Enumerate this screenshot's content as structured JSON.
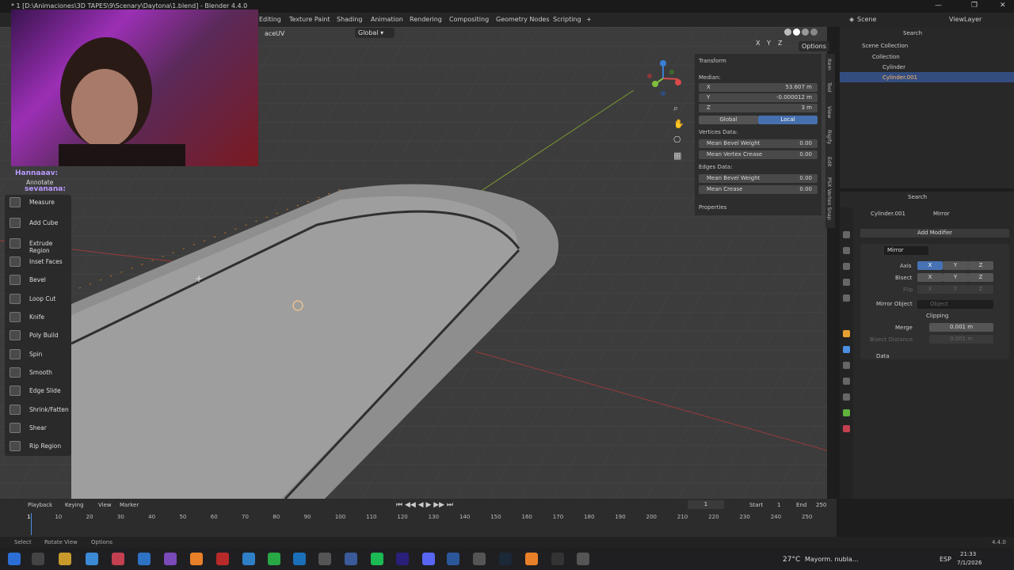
{
  "window": {
    "title": "* 1 [D:\\Animaciones\\3D TAPES\\9\\Scenary\\Daytona\\1.blend] - Blender 4.4.0",
    "minimize": "—",
    "maximize": "❐",
    "close": "✕"
  },
  "workspaces": [
    "Editing",
    "Texture Paint",
    "Shading",
    "Animation",
    "Rendering",
    "Compositing",
    "Geometry Nodes",
    "Scripting",
    "+"
  ],
  "scene": {
    "label": "Scene",
    "view_layer": "ViewLayer"
  },
  "viewport_header": {
    "face_label": "ace",
    "uv_label": "UV",
    "orientation": "Global",
    "options": "Options",
    "axes": [
      "X",
      "Y",
      "Z"
    ]
  },
  "webcam": {
    "chat_line1": "Hannaaav:",
    "chat_line2": "sevanana:"
  },
  "toolbar": {
    "items": [
      "Annotate",
      "Measure",
      "Add Cube",
      "Extrude Region",
      "Inset Faces",
      "Bevel",
      "Loop Cut",
      "Knife",
      "Poly Build",
      "Spin",
      "Smooth",
      "Edge Slide",
      "Shrink/Fatten",
      "Shear",
      "Rip Region"
    ]
  },
  "npanel": {
    "section": "Transform",
    "median": "Median:",
    "x_label": "X",
    "x": "53.607 m",
    "y_label": "Y",
    "y": "-0.000012 m",
    "z_label": "Z",
    "z": "3 m",
    "global": "Global",
    "local": "Local",
    "vertices": "Vertices Data:",
    "mean_bevel": "Mean Bevel Weight",
    "mean_bevel_v": "0.00",
    "mean_crease_v_label": "Mean Vertex Crease",
    "mean_crease_v": "0.00",
    "edges": "Edges Data:",
    "edge_bevel": "Mean Bevel Weight",
    "edge_bevel_v": "0.00",
    "edge_crease": "Mean Crease",
    "edge_crease_v": "0.00",
    "properties": "Properties",
    "tabs": [
      "Item",
      "Tool",
      "View",
      "Rigify",
      "Edit",
      "PSX Vertex Snap"
    ]
  },
  "outliner": {
    "search": "Search",
    "scene_collection": "Scene Collection",
    "collection": "Collection",
    "items": [
      "Cylinder",
      "Cylinder.001"
    ]
  },
  "properties": {
    "search": "Search",
    "breadcrumb_obj": "Cylinder.001",
    "breadcrumb_mod": "Mirror",
    "add_modifier": "Add Modifier",
    "modifier_name": "Mirror",
    "axis": "Axis",
    "bisect": "Bisect",
    "flip": "Flip",
    "x": "X",
    "y": "Y",
    "z": "Z",
    "mirror_object": "Mirror Object",
    "object_placeholder": "Object",
    "clipping": "Clipping",
    "merge": "Merge",
    "merge_value": "0.001 m",
    "bisect_distance": "Bisect Distance",
    "bisect_value": "0.001 m",
    "data": "Data"
  },
  "timeline": {
    "playback": "Playback",
    "keying": "Keying",
    "view": "View",
    "marker": "Marker",
    "current": "1",
    "start_label": "Start",
    "start": "1",
    "end_label": "End",
    "end": "250",
    "ticks": [
      "1",
      "10",
      "20",
      "30",
      "40",
      "50",
      "60",
      "70",
      "80",
      "90",
      "100",
      "110",
      "120",
      "130",
      "140",
      "150",
      "160",
      "170",
      "180",
      "190",
      "200",
      "210",
      "220",
      "230",
      "240",
      "250"
    ]
  },
  "status": {
    "select": "Select",
    "rotate": "Rotate View",
    "options": "Options",
    "version": "4.4.0"
  },
  "taskbar": {
    "weather": "27°C",
    "weather_text": "Mayorm. nubla...",
    "lang": "ESP",
    "time": "21:33",
    "date": "7/1/2026"
  }
}
